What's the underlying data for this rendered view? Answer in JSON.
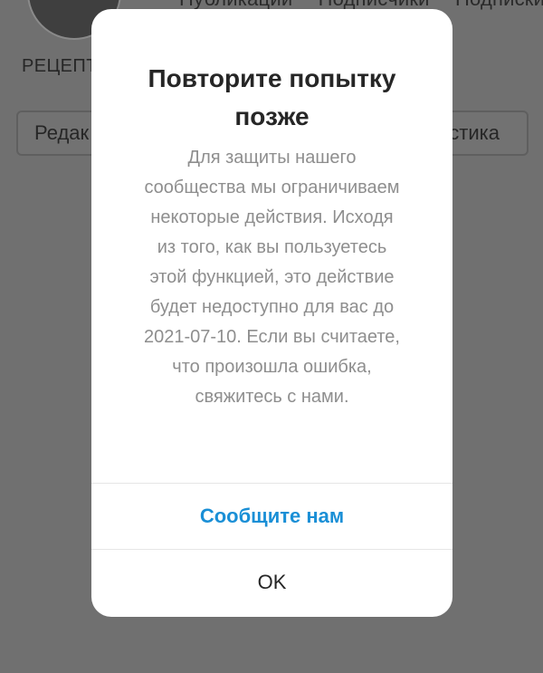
{
  "background": {
    "stats": [
      "Публикации",
      "Подписчики",
      "Подписки"
    ],
    "username": "РЕЦЕПТ",
    "edit_button_label": "Редак",
    "stats_button_label": "стика"
  },
  "dialog": {
    "title": "Повторите попытку позже",
    "message": "Для защиты нашего сообщества мы ограничиваем некоторые действия. Исходя из того, как вы пользуетесь этой функцией, это действие будет недоступно для вас до 2021-07-10. Если вы считаете, что произошла ошибка, свяжитесь с нами.",
    "report_label": "Сообщите нам",
    "ok_label": "OK"
  }
}
